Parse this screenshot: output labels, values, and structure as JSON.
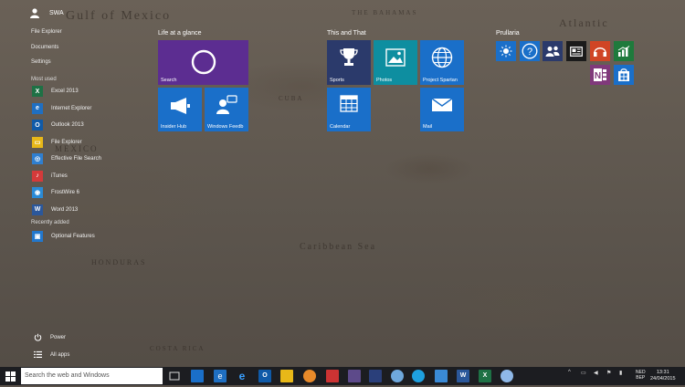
{
  "user": {
    "name": "SWA"
  },
  "links": [
    "File Explorer",
    "Documents",
    "Settings"
  ],
  "most_used_header": "Most used",
  "apps": [
    {
      "label": "Excel 2013",
      "color": "#1e7145",
      "glyph": "X"
    },
    {
      "label": "Internet Explorer",
      "color": "#1f6fc2",
      "glyph": "e"
    },
    {
      "label": "Outlook 2013",
      "color": "#0f5aa8",
      "glyph": "O"
    },
    {
      "label": "File Explorer",
      "color": "#e8b818",
      "glyph": "▭"
    },
    {
      "label": "Effective File Search",
      "color": "#2f7fd0",
      "glyph": "◎"
    },
    {
      "label": "iTunes",
      "color": "#d43a3a",
      "glyph": "♪"
    },
    {
      "label": "FrostWire 6",
      "color": "#2a8ad6",
      "glyph": "◉"
    },
    {
      "label": "Word 2013",
      "color": "#2b579a",
      "glyph": "W"
    }
  ],
  "recently_added_header": "Recently added",
  "recent_apps": [
    {
      "label": "Optional Features",
      "color": "#2277cc",
      "glyph": "▣"
    }
  ],
  "power_label": "Power",
  "all_apps_label": "All apps",
  "groups": {
    "life": "Life at a glance",
    "this_and_that": "This and That",
    "prullaria": "Prullaria"
  },
  "tiles": {
    "search": "Search",
    "insider_hub": "Insider Hub",
    "windows_feedback": "Windows Feedb",
    "sports": "Sports",
    "photos": "Photos",
    "project_spartan": "Project Spartan",
    "calendar": "Calendar",
    "mail": "Mail"
  },
  "map_text": {
    "gulf": "Gulf of Mexico",
    "atlantic": "Atlantic",
    "caribbean": "Caribbean Sea",
    "mexico": "MEXICO",
    "honduras": "HONDURAS",
    "bahamas": "THE BAHAMAS",
    "cuba": "CUBA",
    "costa_rica": "COSTA RICA"
  },
  "taskbar": {
    "search_placeholder": "Search the web and Windows",
    "lang_top": "NED",
    "lang_bottom": "BEP",
    "time": "13:31",
    "date": "24/04/2015"
  },
  "colors": {
    "accent": "#1a6fc9",
    "purple": "#5c2d91",
    "navy": "#2b3a6b",
    "teal": "#0e8ea0",
    "taskbar": "#1c1d21"
  }
}
